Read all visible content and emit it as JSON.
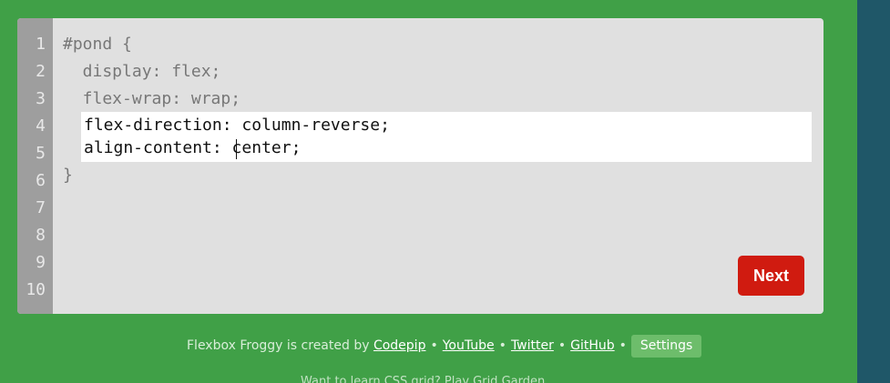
{
  "editor": {
    "line_numbers": [
      "1",
      "2",
      "3",
      "4",
      "5",
      "6",
      "7",
      "8",
      "9",
      "10"
    ],
    "code_lines": [
      "#pond {",
      "  display: flex;",
      "  flex-wrap: wrap;",
      "}"
    ],
    "input_lines": [
      "flex-direction: column-reverse;",
      "align-content: center;"
    ],
    "next_label": "Next"
  },
  "footer": {
    "prefix": "Flexbox Froggy is created by",
    "links": [
      "Codepip",
      "YouTube",
      "Twitter",
      "GitHub"
    ],
    "separator": "•",
    "settings_label": "Settings",
    "partial_text": "Want to learn CSS grid? Play Grid Garden."
  },
  "colors": {
    "background": "#40a047",
    "editor_background": "#e0e0e0",
    "gutter": "#9e9e9e",
    "next_button": "#d01b10",
    "settings_button": "#6dbd6b",
    "right_panel": "#1f5768"
  }
}
